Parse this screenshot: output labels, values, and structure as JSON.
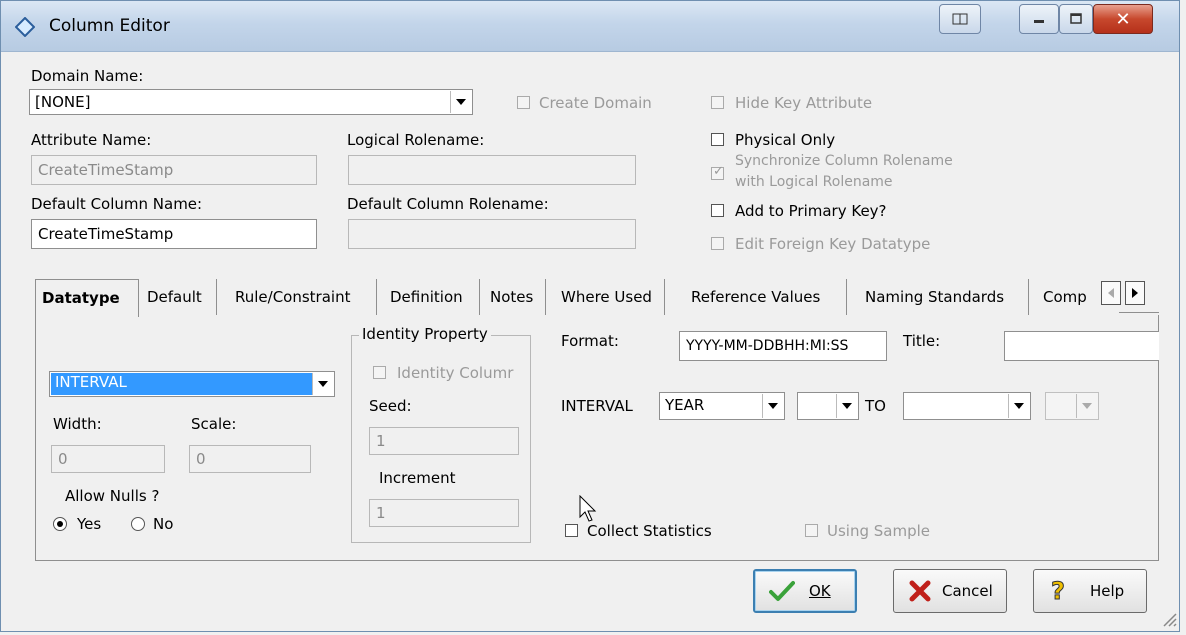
{
  "window": {
    "title": "Column Editor"
  },
  "domain": {
    "label": "Domain Name:",
    "value": "[NONE]",
    "create_domain_label": "Create Domain",
    "hide_key_label": "Hide Key Attribute"
  },
  "attribute": {
    "label": "Attribute Name:",
    "value": "CreateTimeStamp"
  },
  "logical_rolename": {
    "label": "Logical Rolename:",
    "value": ""
  },
  "default_column": {
    "label": "Default Column Name:",
    "value": "CreateTimeStamp"
  },
  "default_rolename": {
    "label": "Default Column Rolename:",
    "value": ""
  },
  "options": {
    "physical_only": "Physical Only",
    "synchronize_line1": "Synchronize Column Rolename",
    "synchronize_line2": "with Logical Rolename",
    "add_primary_key": "Add to Primary Key?",
    "edit_fk_datatype": "Edit Foreign Key Datatype"
  },
  "tabs": [
    "Datatype",
    "Default",
    "Rule/Constraint",
    "Definition",
    "Notes",
    "Where Used",
    "Reference Values",
    "Naming Standards",
    "Comp"
  ],
  "datatype": {
    "type_value": "INTERVAL",
    "width_label": "Width:",
    "width_value": "0",
    "scale_label": "Scale:",
    "scale_value": "0",
    "allow_nulls_label": "Allow Nulls ?",
    "yes_label": "Yes",
    "no_label": "No",
    "identity_title": "Identity Property",
    "identity_column_label": "Identity Columr",
    "seed_label": "Seed:",
    "seed_value": "1",
    "increment_label": "Increment",
    "increment_value": "1",
    "format_label": "Format:",
    "format_value": "YYYY-MM-DDBHH:MI:SS",
    "title_label": "Title:",
    "title_value": "",
    "interval_label": "INTERVAL",
    "interval_from": "YEAR",
    "interval_from_prec": "",
    "to_label": "TO",
    "interval_to": "",
    "interval_to_prec": "",
    "collect_stats_label": "Collect Statistics",
    "using_sample_label": "Using Sample"
  },
  "buttons": {
    "ok": "OK",
    "cancel": "Cancel",
    "help": "Help"
  }
}
